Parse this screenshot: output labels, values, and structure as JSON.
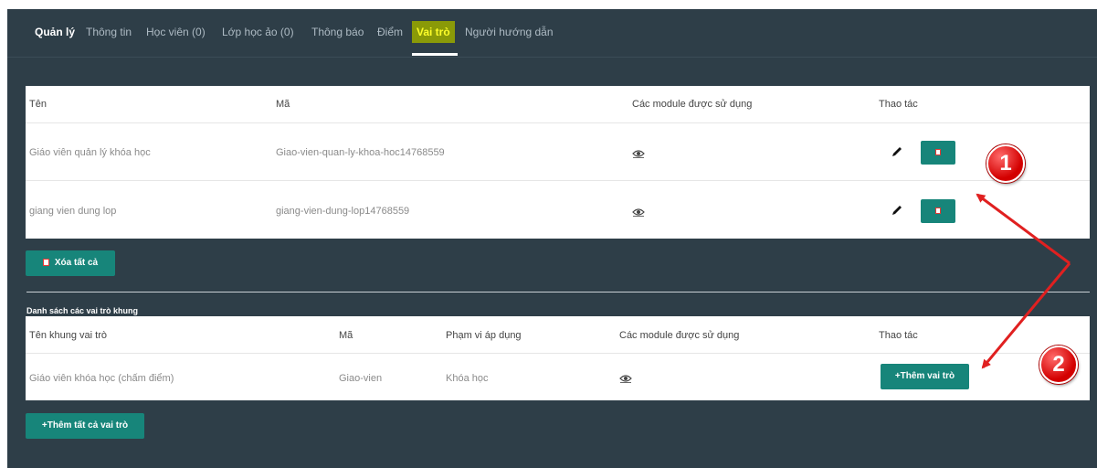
{
  "tabs": [
    {
      "label": "Quản lý"
    },
    {
      "label": "Thông tin"
    },
    {
      "label": "Học viên (0)"
    },
    {
      "label": "Lớp học ảo (0)"
    },
    {
      "label": "Thông báo"
    },
    {
      "label": "Điểm"
    },
    {
      "label": "Vai trò"
    },
    {
      "label": "Người hướng dẫn"
    }
  ],
  "roles_table": {
    "headers": {
      "name": "Tên",
      "code": "Mã",
      "modules": "Các module được sử dụng",
      "actions": "Thao tác"
    },
    "rows": [
      {
        "name": "Giáo viên quản lý khóa học",
        "code": "Giao-vien-quan-ly-khoa-hoc14768559",
        "modules_icon": "eye-icon"
      },
      {
        "name": "giang vien dung lop",
        "code": "giang-vien-dung-lop14768559",
        "modules_icon": "eye-icon"
      }
    ]
  },
  "delete_all_label": "Xóa tất cả",
  "frame_section": {
    "title": "Danh sách các vai trò khung",
    "headers": {
      "name": "Tên khung vai trò",
      "code": "Mã",
      "scope": "Phạm vi áp dụng",
      "modules": "Các module được sử dụng",
      "actions": "Thao tác"
    },
    "rows": [
      {
        "name": "Giáo viên khóa học (chấm điểm)",
        "code": "Giao-vien",
        "scope": "Khóa học",
        "action_label": "+Thêm vai trò"
      }
    ]
  },
  "add_all_label": "+Thêm tất cả vai trò",
  "annotations": [
    {
      "label": "1"
    },
    {
      "label": "2"
    }
  ],
  "colors": {
    "background": "#2e3e48",
    "accent": "#17857a",
    "active_tab_text": "#fdfd2a",
    "annotation": "#d30000"
  }
}
